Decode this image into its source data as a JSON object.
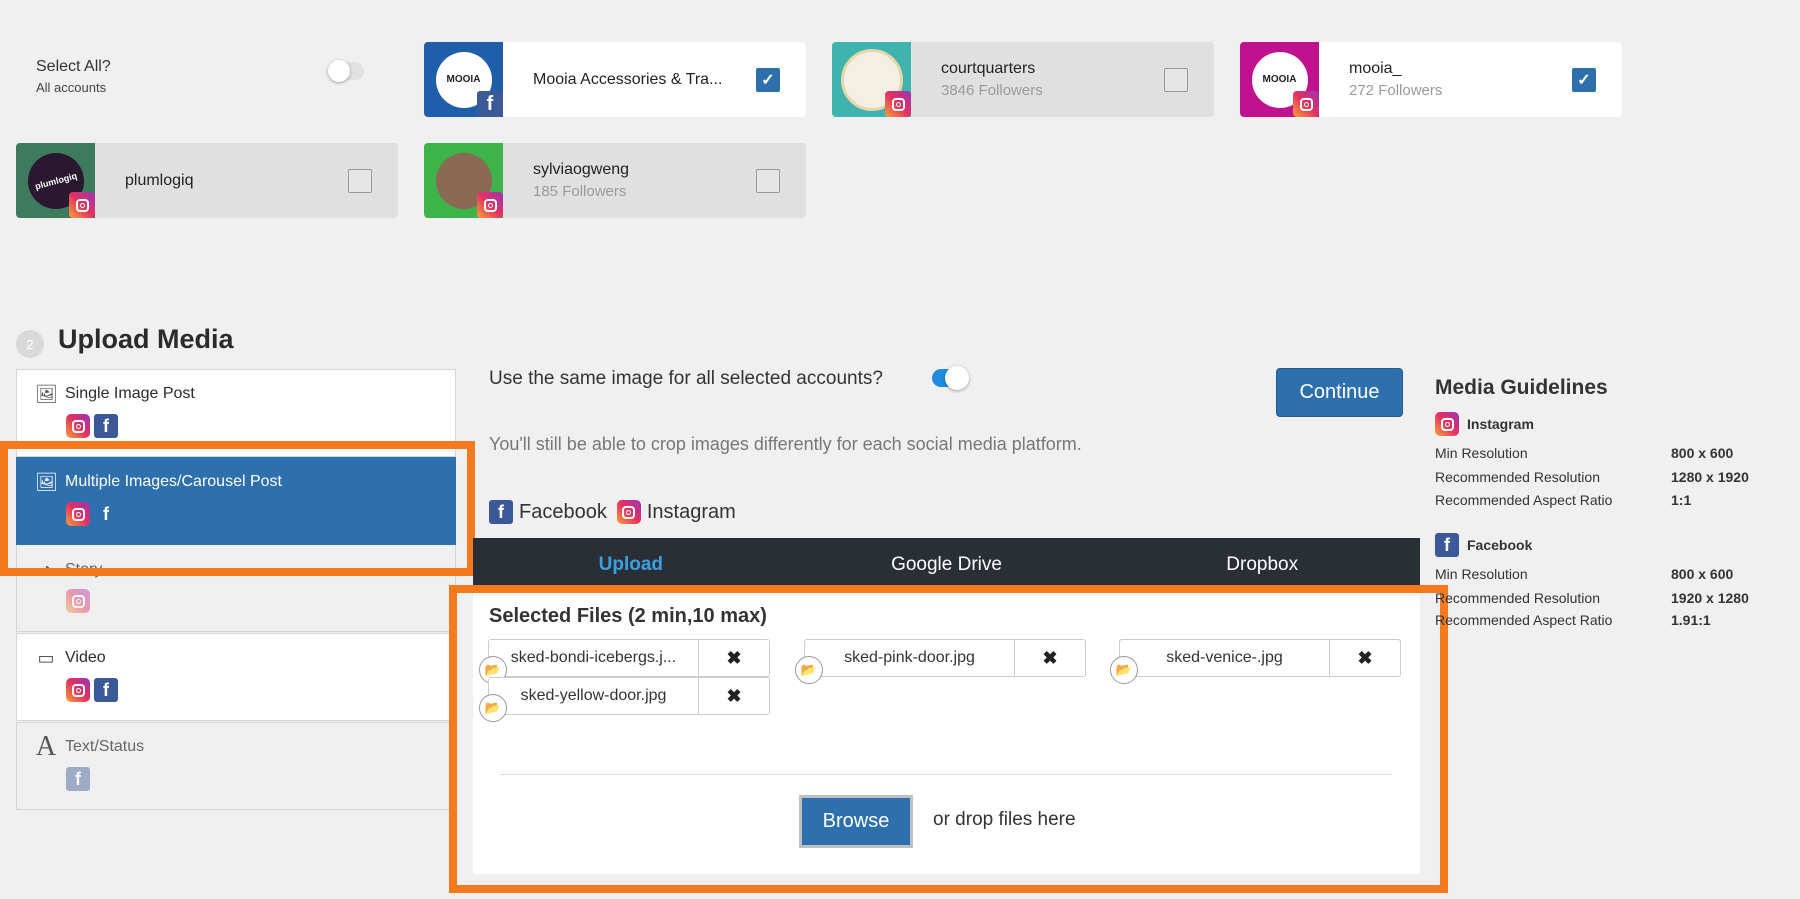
{
  "accounts_header": {
    "select_all_label": "Select All?",
    "select_all_sub": "All accounts"
  },
  "accounts": [
    {
      "name": "Mooia Accessories & Tra...",
      "followers": "",
      "network": "facebook",
      "avatar_text": "MOOIA",
      "selected": true,
      "avatar_bg": "#1f5ea8"
    },
    {
      "name": "courtquarters",
      "followers": "3846 Followers",
      "network": "instagram",
      "avatar_text": "",
      "selected": false,
      "avatar_bg": "#3fb3ae"
    },
    {
      "name": "mooia_",
      "followers": "272 Followers",
      "network": "instagram",
      "avatar_text": "MOOIA",
      "selected": true,
      "avatar_bg": "#c0128f"
    },
    {
      "name": "plumlogiq",
      "followers": "",
      "network": "instagram",
      "avatar_text": "plumlogiq",
      "selected": false,
      "avatar_bg": "#3d7a5e"
    },
    {
      "name": "sylviaogweng",
      "followers": "185 Followers",
      "network": "instagram",
      "avatar_text": "",
      "selected": false,
      "avatar_bg": "#3db34a"
    }
  ],
  "upload": {
    "step_number": "2",
    "title": "Upload Media",
    "post_types": [
      {
        "label": "Single Image Post",
        "icon": "image-icon",
        "networks": [
          "instagram",
          "facebook"
        ]
      },
      {
        "label": "Multiple Images/Carousel Post",
        "icon": "images-icon",
        "networks": [
          "instagram",
          "facebook"
        ]
      },
      {
        "label": "Story",
        "icon": "story-icon",
        "networks": [
          "instagram"
        ]
      },
      {
        "label": "Video",
        "icon": "video-icon",
        "networks": [
          "instagram",
          "facebook"
        ]
      },
      {
        "label": "Text/Status",
        "icon": "text-icon",
        "networks": [
          "facebook"
        ]
      }
    ],
    "same_image_question": "Use the same image for all selected accounts?",
    "crop_note": "You'll still be able to crop images differently for each social media platform.",
    "continue_label": "Continue",
    "network_labels": {
      "facebook": "Facebook",
      "instagram": "Instagram"
    },
    "tabs": [
      "Upload",
      "Google Drive",
      "Dropbox"
    ],
    "selected_files_title": "Selected Files (2 min,10 max)",
    "files": [
      "sked-bondi-icebergs.j...",
      "sked-pink-door.jpg",
      "sked-venice-.jpg",
      "sked-yellow-door.jpg"
    ],
    "browse_label": "Browse",
    "drop_label": "or drop files here"
  },
  "guidelines": {
    "title": "Media Guidelines",
    "instagram": {
      "label": "Instagram",
      "rows": [
        [
          "Min Resolution",
          "800 x 600"
        ],
        [
          "Recommended Resolution",
          "1280 x 1920"
        ],
        [
          "Recommended Aspect Ratio",
          "1:1"
        ]
      ]
    },
    "facebook": {
      "label": "Facebook",
      "rows": [
        [
          "Min Resolution",
          "800 x 600"
        ],
        [
          "Recommended Resolution",
          "1920 x 1280"
        ],
        [
          "Recommended Aspect Ratio",
          "1.91:1"
        ]
      ]
    }
  },
  "colors": {
    "accent": "#2e6fad",
    "highlight": "#f47a1e",
    "tab_bar": "#2a2f36"
  }
}
